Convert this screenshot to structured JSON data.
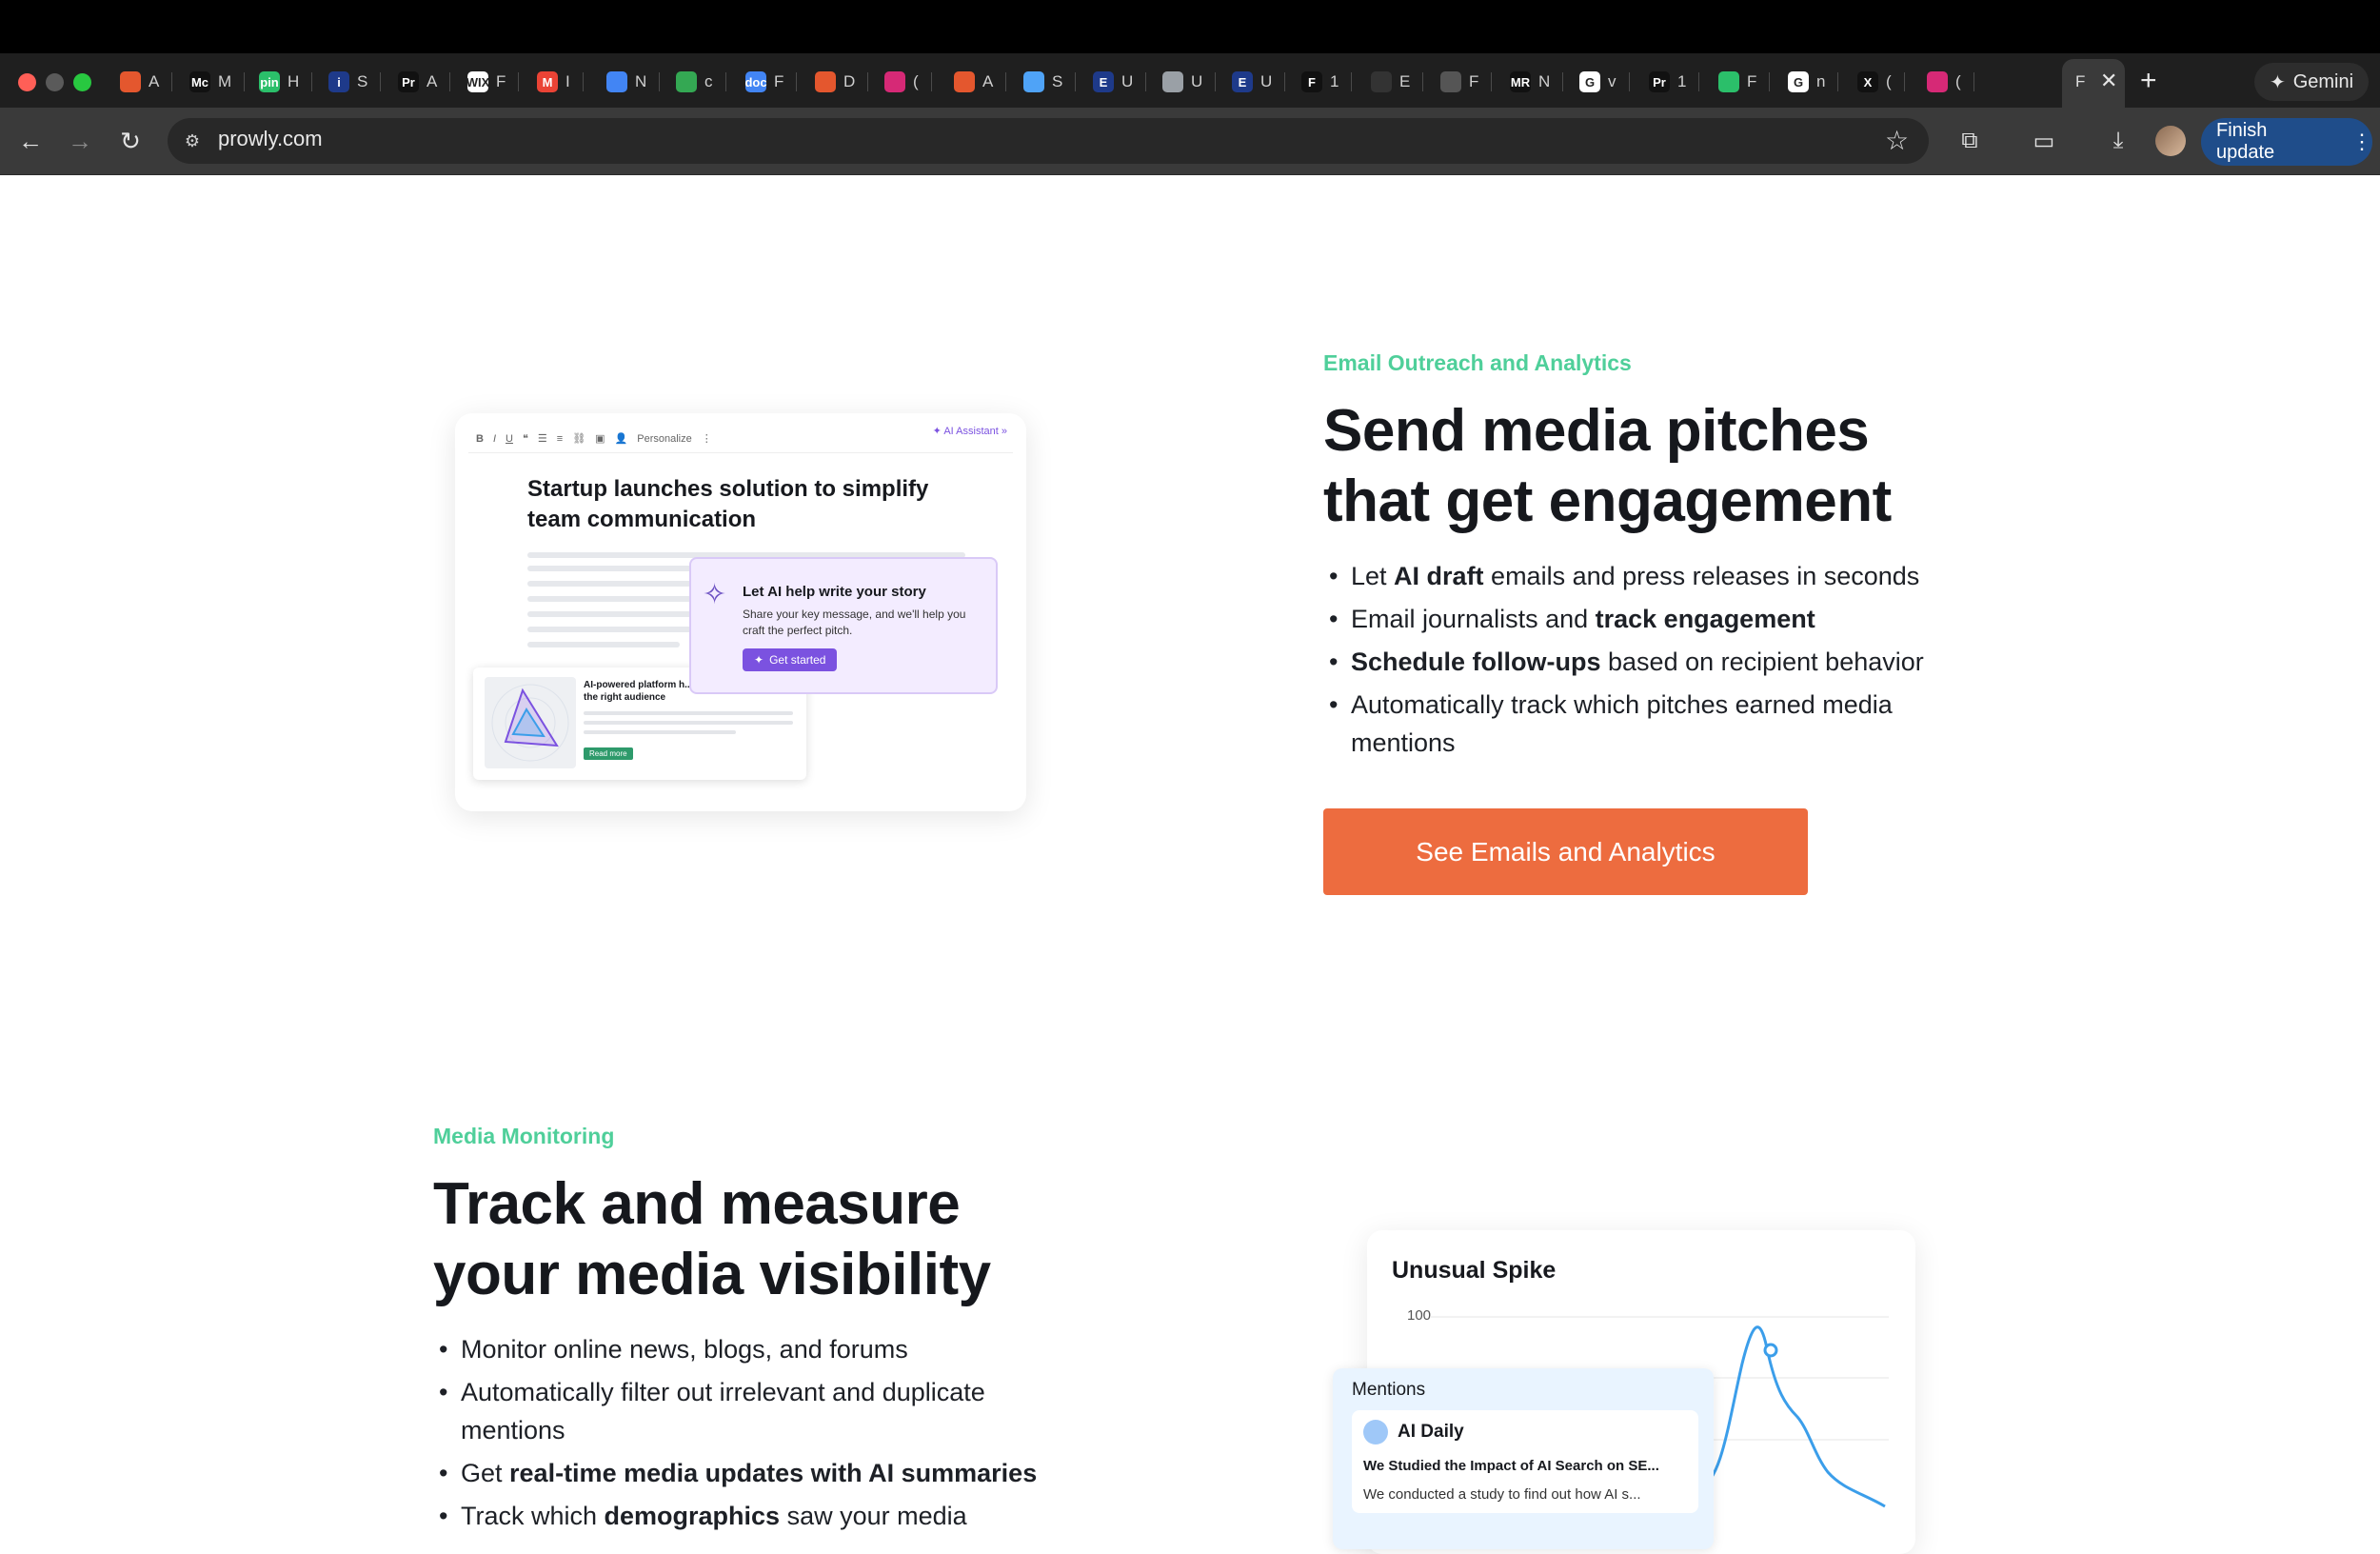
{
  "browser": {
    "tabs": [
      {
        "letter": "A",
        "fav": "arrow-mark",
        "color": "#e4572e"
      },
      {
        "letter": "M",
        "fav": "Mc",
        "color": "#111111"
      },
      {
        "letter": "H",
        "fav": "pin",
        "color": "#2bbf6a"
      },
      {
        "letter": "S",
        "fav": "i",
        "color": "#1e3a8a"
      },
      {
        "letter": "A",
        "fav": "Pr",
        "color": "#111111"
      },
      {
        "letter": "F",
        "fav": "WIX",
        "color": "#ffffff"
      },
      {
        "letter": "I",
        "fav": "M",
        "color": "#ea4335"
      },
      {
        "letter": "N",
        "fav": "bookmark",
        "color": "#4285f4"
      },
      {
        "letter": "c",
        "fav": "robot",
        "color": "#34a853"
      },
      {
        "letter": "F",
        "fav": "doc",
        "color": "#4285f4"
      },
      {
        "letter": "D",
        "fav": "arrow-mark",
        "color": "#e4572e"
      },
      {
        "letter": "(",
        "fav": "insta",
        "color": "#d62976"
      },
      {
        "letter": "A",
        "fav": "arrow-mark",
        "color": "#e4572e"
      },
      {
        "letter": "S",
        "fav": "cloud",
        "color": "#4fa3f7"
      },
      {
        "letter": "U",
        "fav": "E",
        "color": "#1e3a8a"
      },
      {
        "letter": "U",
        "fav": "globe",
        "color": "#9aa0a6"
      },
      {
        "letter": "U",
        "fav": "E",
        "color": "#1e3a8a"
      },
      {
        "letter": "1",
        "fav": "F",
        "color": "#111111"
      },
      {
        "letter": "E",
        "fav": "stripes",
        "color": "#333333"
      },
      {
        "letter": "F",
        "fav": "cube",
        "color": "#555555"
      },
      {
        "letter": "N",
        "fav": "MR",
        "color": "#111111"
      },
      {
        "letter": "v",
        "fav": "G",
        "color": "#ffffff"
      },
      {
        "letter": "1",
        "fav": "Pr",
        "color": "#111111"
      },
      {
        "letter": "F",
        "fav": "square",
        "color": "#2bbf6a"
      },
      {
        "letter": "n",
        "fav": "G",
        "color": "#ffffff"
      },
      {
        "letter": "(",
        "fav": "X",
        "color": "#111111"
      },
      {
        "letter": "(",
        "fav": "insta",
        "color": "#d62976"
      }
    ],
    "active_tab_letter": "F",
    "gemini_label": "Gemini",
    "url": "prowly.com",
    "finish_update_label": "Finish update"
  },
  "section1": {
    "eyebrow": "Email Outreach and Analytics",
    "headline_line1": "Send media pitches",
    "headline_line2": "that get engagement",
    "bullets": [
      {
        "pre": "Let ",
        "bold": "AI draft",
        "post": " emails and press releases in seconds"
      },
      {
        "pre": "Email journalists and ",
        "bold": "track engagement",
        "post": ""
      },
      {
        "pre": "",
        "bold": "Schedule follow-ups",
        "post": " based on recipient behavior"
      },
      {
        "pre": "Automatically track which pitches earned media mentions",
        "bold": "",
        "post": ""
      }
    ],
    "cta_label": "See Emails and Analytics",
    "editor": {
      "toolbar_personalize": "Personalize",
      "ai_assistant": "AI Assistant",
      "title": "Startup launches solution to simplify team communication",
      "ai_pop_title": "Let AI help write your story",
      "ai_pop_desc": "Share your key message, and we'll help you craft the perfect pitch.",
      "ai_pop_button": "Get started",
      "mini_card_title": "AI-powered platform h... the right audience",
      "mini_card_button": "Read more"
    }
  },
  "section2": {
    "eyebrow": "Media Monitoring",
    "headline_line1": "Track and measure",
    "headline_line2": "your media visibility",
    "bullets": [
      {
        "pre": "Monitor online news, blogs, and forums",
        "bold": "",
        "post": ""
      },
      {
        "pre": "Automatically filter out irrelevant and duplicate mentions",
        "bold": "",
        "post": ""
      },
      {
        "pre": "Get ",
        "bold": "real-time media updates with AI summaries",
        "post": ""
      },
      {
        "pre": "Track which ",
        "bold": "demographics",
        "post": " saw your media"
      }
    ],
    "chart": {
      "title": "Unusual Spike",
      "y_tick": "100",
      "mentions_heading": "Mentions",
      "mention_source": "AI Daily",
      "mention_headline": "We Studied the Impact of AI Search on SE...",
      "mention_summary": "We conducted a study to find out how AI s..."
    }
  },
  "colors": {
    "accent_green": "#4fcf9a",
    "cta_orange": "#ed6c3f",
    "ai_purple": "#7b52e0",
    "chart_blue": "#3b9eea"
  }
}
